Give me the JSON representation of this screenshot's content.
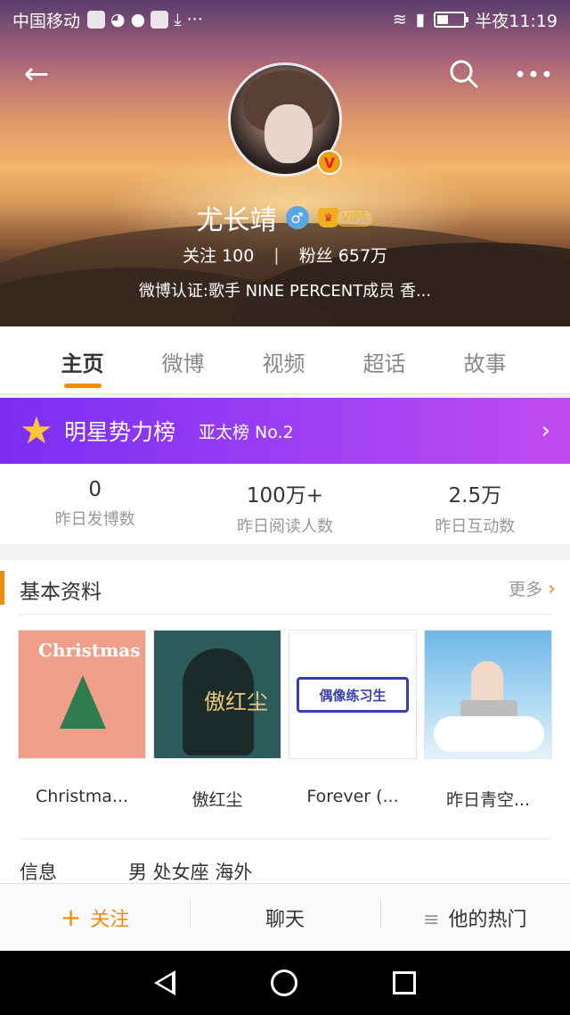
{
  "status_bar": {
    "carrier": "中国移动",
    "time": "半夜11:19",
    "icons": [
      "shield-icon",
      "wechat-icon",
      "chat-icon",
      "baidu-icon",
      "download-icon",
      "more-dots-icon",
      "wifi-icon",
      "signal-icon",
      "battery-icon"
    ]
  },
  "header": {
    "back_icon": "back-arrow-icon",
    "search_icon": "search-icon",
    "more_icon": "more-icon",
    "name": "尤长靖",
    "gender_icon": "male-icon",
    "vip_label": "VIP5",
    "verified_badge": "V",
    "following_label": "关注",
    "following_count": "100",
    "followers_label": "粉丝",
    "followers_count": "657万",
    "verification": "微博认证:歌手 NINE PERCENT成员 香..."
  },
  "tabs": [
    {
      "label": "主页",
      "active": true
    },
    {
      "label": "微博",
      "active": false
    },
    {
      "label": "视频",
      "active": false
    },
    {
      "label": "超话",
      "active": false
    },
    {
      "label": "故事",
      "active": false
    }
  ],
  "banner": {
    "title": "明星势力榜",
    "rank": "亚太榜 No.2",
    "color": "#9b3ef4"
  },
  "stats": [
    {
      "value": "0",
      "label": "昨日发博数"
    },
    {
      "value": "100万+",
      "label": "昨日阅读人数"
    },
    {
      "value": "2.5万",
      "label": "昨日互动数"
    }
  ],
  "basic_info": {
    "heading": "基本资料",
    "more": "更多",
    "covers": [
      {
        "label": "Christma...",
        "art_text": "Christmas"
      },
      {
        "label": "傲红尘",
        "art_text": "傲红尘"
      },
      {
        "label": "Forever (...",
        "art_text": "偶像练习生"
      },
      {
        "label": "昨日青空...",
        "art_text": ""
      }
    ],
    "info_key": "信息",
    "info_value": "男 处女座 海外"
  },
  "action_bar": {
    "follow": "关注",
    "chat": "聊天",
    "hot": "他的热门"
  },
  "accent_color": "#f28c0f"
}
